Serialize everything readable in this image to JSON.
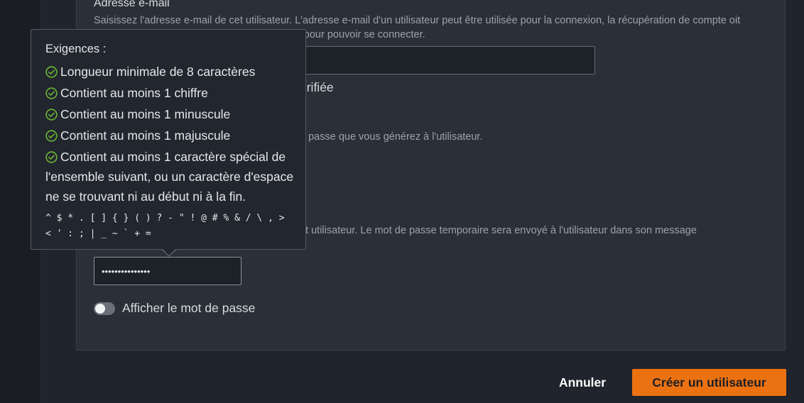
{
  "form": {
    "email_label": "Adresse e-mail",
    "email_description": "Saisissez l'adresse e-mail de cet utilisateur. L'adresse e-mail d'un utilisateur peut être utilisée pour la connexion, la récupération de compte oit confirmer la propriété de cette adresse e-mail pour pouvoir se connecter.",
    "email_value": "",
    "email_verified_label": "érifiée",
    "password_generated_desc": "e passe que vous générez à l'utilisateur.",
    "temporary_password_desc": "et utilisateur. Le mot de passe temporaire sera envoyé à l'utilisateur dans son message",
    "password_value": "•••••••••••••••",
    "show_password_label": "Afficher le mot de passe",
    "show_password_on": false
  },
  "requirements": {
    "title": "Exigences :",
    "items": [
      "Longueur minimale de 8 caractères",
      "Contient au moins 1 chiffre",
      "Contient au moins 1 minuscule",
      "Contient au moins 1 majuscule",
      "Contient au moins 1 caractère spécial de l'ensemble suivant, ou un caractère d'espace ne se trouvant ni au début ni à la fin."
    ],
    "special_chars": "^ $ * . [ ] { } ( ) ? - \" ! @ # % & / \\ , > < ' : ; | _ ~ ` + ="
  },
  "footer": {
    "cancel_label": "Annuler",
    "create_label": "Créer un utilisateur"
  },
  "colors": {
    "accent": "#ec7211",
    "check_green": "#6aaf35"
  }
}
